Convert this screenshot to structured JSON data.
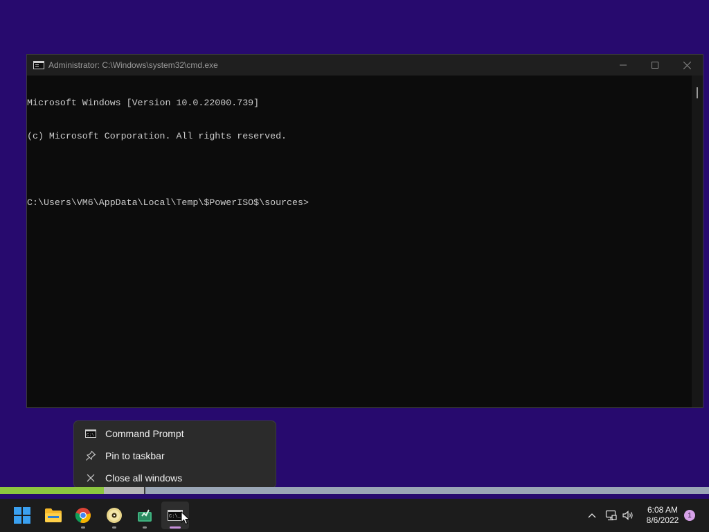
{
  "desktop": {
    "background": "#270a6e"
  },
  "cmd_window": {
    "title": "Administrator: C:\\Windows\\system32\\cmd.exe",
    "console_lines": [
      "Microsoft Windows [Version 10.0.22000.739]",
      "(c) Microsoft Corporation. All rights reserved.",
      "",
      "C:\\Users\\VM6\\AppData\\Local\\Temp\\$PowerISO$\\sources>"
    ],
    "controls": {
      "minimize_icon": "minimize-icon",
      "maximize_icon": "maximize-icon",
      "close_icon": "close-icon"
    }
  },
  "jump_list": {
    "items": [
      {
        "label": "Command Prompt",
        "icon": "cmd-icon"
      },
      {
        "label": "Pin to taskbar",
        "icon": "pin-icon"
      },
      {
        "label": "Close all windows",
        "icon": "close-icon"
      }
    ]
  },
  "taskbar": {
    "apps": [
      {
        "name": "start",
        "icon": "windows-start-icon",
        "running": false
      },
      {
        "name": "file-explorer",
        "icon": "folder-icon",
        "running": false
      },
      {
        "name": "chrome",
        "icon": "chrome-icon",
        "running": true
      },
      {
        "name": "poweriso",
        "icon": "disc-icon",
        "running": true
      },
      {
        "name": "app-green",
        "icon": "green-app-icon",
        "running": true
      },
      {
        "name": "command-prompt",
        "icon": "cmd-icon",
        "running": true,
        "active": true
      }
    ],
    "tray": {
      "chevron_icon": "chevron-up-icon",
      "network_icon": "network-icon",
      "volume_icon": "volume-icon"
    },
    "clock": {
      "time": "6:08 AM",
      "date": "8/6/2022"
    },
    "notification_count": "1"
  },
  "colors": {
    "accent_indicator": "#c58fd9",
    "badge": "#d6a1e8"
  }
}
